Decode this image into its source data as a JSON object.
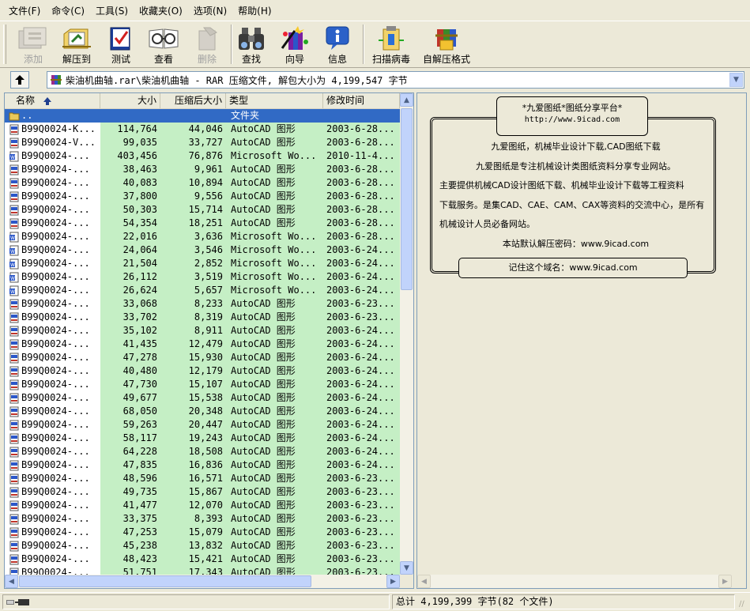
{
  "menu": [
    "文件(F)",
    "命令(C)",
    "工具(S)",
    "收藏夹(O)",
    "选项(N)",
    "帮助(H)"
  ],
  "toolbar": {
    "add": "添加",
    "extract": "解压到",
    "test": "测试",
    "view": "查看",
    "delete": "删除",
    "find": "查找",
    "wizard": "向导",
    "info": "信息",
    "scan": "扫描病毒",
    "sfx": "自解压格式"
  },
  "path": {
    "text": "柴油机曲轴.rar\\柴油机曲轴 - RAR 压缩文件, 解包大小为 4,199,547 字节"
  },
  "columns": {
    "name": "名称",
    "size": "大小",
    "packed": "压缩后大小",
    "type": "类型",
    "modified": "修改时间"
  },
  "rows": [
    {
      "name": "..",
      "size": "",
      "packed": "",
      "type": "文件夹",
      "modified": "",
      "icon": "folder-icon",
      "selected": true
    },
    {
      "name": "B99Q0024-K...",
      "size": "114,764",
      "packed": "44,046",
      "type": "AutoCAD 图形",
      "modified": "2003-6-28...",
      "icon": "dwg-file-icon"
    },
    {
      "name": "B99Q0024-V...",
      "size": "99,035",
      "packed": "33,727",
      "type": "AutoCAD 图形",
      "modified": "2003-6-28...",
      "icon": "dwg-file-icon"
    },
    {
      "name": "B99Q0024-...",
      "size": "403,456",
      "packed": "76,876",
      "type": "Microsoft Wo...",
      "modified": "2010-11-4...",
      "icon": "doc-file-icon"
    },
    {
      "name": "B99Q0024-...",
      "size": "38,463",
      "packed": "9,961",
      "type": "AutoCAD 图形",
      "modified": "2003-6-28...",
      "icon": "dwg-file-icon"
    },
    {
      "name": "B99Q0024-...",
      "size": "40,083",
      "packed": "10,894",
      "type": "AutoCAD 图形",
      "modified": "2003-6-28...",
      "icon": "dwg-file-icon"
    },
    {
      "name": "B99Q0024-...",
      "size": "37,800",
      "packed": "9,556",
      "type": "AutoCAD 图形",
      "modified": "2003-6-28...",
      "icon": "dwg-file-icon"
    },
    {
      "name": "B99Q0024-...",
      "size": "50,303",
      "packed": "15,714",
      "type": "AutoCAD 图形",
      "modified": "2003-6-28...",
      "icon": "dwg-file-icon"
    },
    {
      "name": "B99Q0024-...",
      "size": "54,354",
      "packed": "18,251",
      "type": "AutoCAD 图形",
      "modified": "2003-6-28...",
      "icon": "dwg-file-icon"
    },
    {
      "name": "B99Q0024-...",
      "size": "22,016",
      "packed": "3,636",
      "type": "Microsoft Wo...",
      "modified": "2003-6-28...",
      "icon": "doc-file-icon"
    },
    {
      "name": "B99Q0024-...",
      "size": "24,064",
      "packed": "3,546",
      "type": "Microsoft Wo...",
      "modified": "2003-6-24...",
      "icon": "doc-file-icon"
    },
    {
      "name": "B99Q0024-...",
      "size": "21,504",
      "packed": "2,852",
      "type": "Microsoft Wo...",
      "modified": "2003-6-24...",
      "icon": "doc-file-icon"
    },
    {
      "name": "B99Q0024-...",
      "size": "26,112",
      "packed": "3,519",
      "type": "Microsoft Wo...",
      "modified": "2003-6-24...",
      "icon": "doc-file-icon"
    },
    {
      "name": "B99Q0024-...",
      "size": "26,624",
      "packed": "5,657",
      "type": "Microsoft Wo...",
      "modified": "2003-6-24...",
      "icon": "doc-file-icon"
    },
    {
      "name": "B99Q0024-...",
      "size": "33,068",
      "packed": "8,233",
      "type": "AutoCAD 图形",
      "modified": "2003-6-23...",
      "icon": "dwg-file-icon"
    },
    {
      "name": "B99Q0024-...",
      "size": "33,702",
      "packed": "8,319",
      "type": "AutoCAD 图形",
      "modified": "2003-6-23...",
      "icon": "dwg-file-icon"
    },
    {
      "name": "B99Q0024-...",
      "size": "35,102",
      "packed": "8,911",
      "type": "AutoCAD 图形",
      "modified": "2003-6-24...",
      "icon": "dwg-file-icon"
    },
    {
      "name": "B99Q0024-...",
      "size": "41,435",
      "packed": "12,479",
      "type": "AutoCAD 图形",
      "modified": "2003-6-24...",
      "icon": "dwg-file-icon"
    },
    {
      "name": "B99Q0024-...",
      "size": "47,278",
      "packed": "15,930",
      "type": "AutoCAD 图形",
      "modified": "2003-6-24...",
      "icon": "dwg-file-icon"
    },
    {
      "name": "B99Q0024-...",
      "size": "40,480",
      "packed": "12,179",
      "type": "AutoCAD 图形",
      "modified": "2003-6-24...",
      "icon": "dwg-file-icon"
    },
    {
      "name": "B99Q0024-...",
      "size": "47,730",
      "packed": "15,107",
      "type": "AutoCAD 图形",
      "modified": "2003-6-24...",
      "icon": "dwg-file-icon"
    },
    {
      "name": "B99Q0024-...",
      "size": "49,677",
      "packed": "15,538",
      "type": "AutoCAD 图形",
      "modified": "2003-6-24...",
      "icon": "dwg-file-icon"
    },
    {
      "name": "B99Q0024-...",
      "size": "68,050",
      "packed": "20,348",
      "type": "AutoCAD 图形",
      "modified": "2003-6-24...",
      "icon": "dwg-file-icon"
    },
    {
      "name": "B99Q0024-...",
      "size": "59,263",
      "packed": "20,447",
      "type": "AutoCAD 图形",
      "modified": "2003-6-24...",
      "icon": "dwg-file-icon"
    },
    {
      "name": "B99Q0024-...",
      "size": "58,117",
      "packed": "19,243",
      "type": "AutoCAD 图形",
      "modified": "2003-6-24...",
      "icon": "dwg-file-icon"
    },
    {
      "name": "B99Q0024-...",
      "size": "64,228",
      "packed": "18,508",
      "type": "AutoCAD 图形",
      "modified": "2003-6-24...",
      "icon": "dwg-file-icon"
    },
    {
      "name": "B99Q0024-...",
      "size": "47,835",
      "packed": "16,836",
      "type": "AutoCAD 图形",
      "modified": "2003-6-24...",
      "icon": "dwg-file-icon"
    },
    {
      "name": "B99Q0024-...",
      "size": "48,596",
      "packed": "16,571",
      "type": "AutoCAD 图形",
      "modified": "2003-6-23...",
      "icon": "dwg-file-icon"
    },
    {
      "name": "B99Q0024-...",
      "size": "49,735",
      "packed": "15,867",
      "type": "AutoCAD 图形",
      "modified": "2003-6-23...",
      "icon": "dwg-file-icon"
    },
    {
      "name": "B99Q0024-...",
      "size": "41,477",
      "packed": "12,070",
      "type": "AutoCAD 图形",
      "modified": "2003-6-23...",
      "icon": "dwg-file-icon"
    },
    {
      "name": "B99Q0024-...",
      "size": "33,375",
      "packed": "8,393",
      "type": "AutoCAD 图形",
      "modified": "2003-6-23...",
      "icon": "dwg-file-icon"
    },
    {
      "name": "B99Q0024-...",
      "size": "47,253",
      "packed": "15,079",
      "type": "AutoCAD 图形",
      "modified": "2003-6-23...",
      "icon": "dwg-file-icon"
    },
    {
      "name": "B99Q0024-...",
      "size": "45,238",
      "packed": "13,832",
      "type": "AutoCAD 图形",
      "modified": "2003-6-23...",
      "icon": "dwg-file-icon"
    },
    {
      "name": "B99Q0024-...",
      "size": "48,423",
      "packed": "15,421",
      "type": "AutoCAD 图形",
      "modified": "2003-6-23...",
      "icon": "dwg-file-icon"
    },
    {
      "name": "B99Q0024-...",
      "size": "51,751",
      "packed": "17,343",
      "type": "AutoCAD 图形",
      "modified": "2003-6-23...",
      "icon": "dwg-file-icon"
    }
  ],
  "comment": {
    "title": "*九爱图纸*图纸分享平台*",
    "url": "http://www.9icad.com",
    "line1": "九爱图纸，机械毕业设计下载,CAD图纸下载",
    "line2": "九爱图纸是专注机械设计类图纸资料分享专业网站。",
    "line3": "主要提供机械CAD设计图纸下载、机械毕业设计下载等工程资料",
    "line4": "下载服务。是集CAD、CAE、CAM、CAX等资料的交流中心，是所有",
    "line5": "机械设计人员必备网站。",
    "line6": "本站默认解压密码：www.9icad.com",
    "footer": "记住这个域名：www.9icad.com"
  },
  "status": {
    "total": "总计 4,199,399 字节(82 个文件)"
  }
}
